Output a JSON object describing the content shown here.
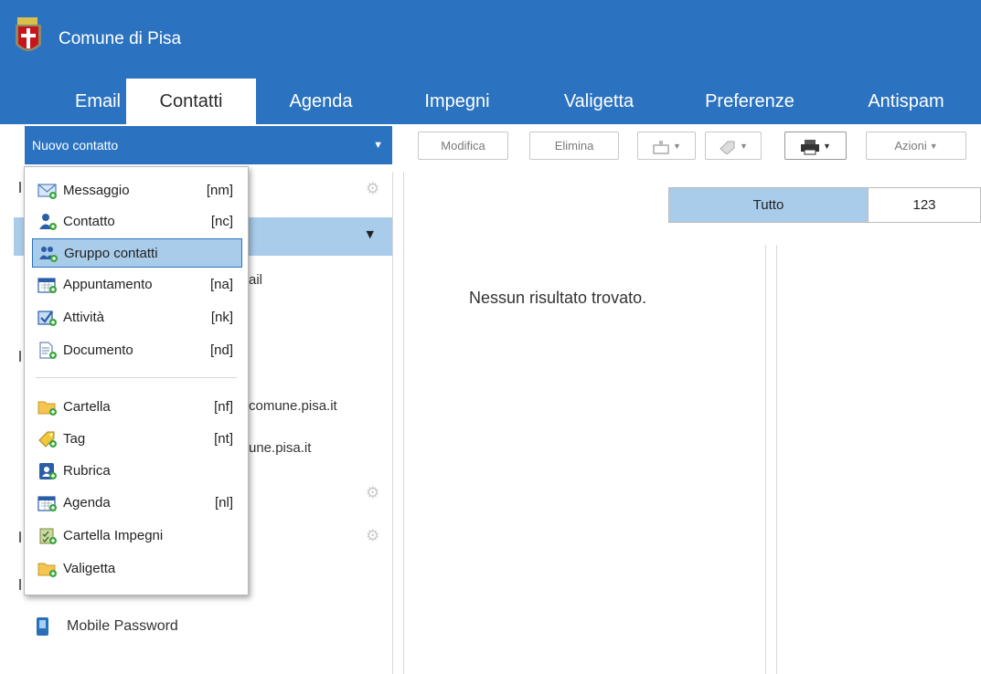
{
  "header": {
    "app_title": "Comune di Pisa",
    "tabs": [
      {
        "label": "Email"
      },
      {
        "label": "Contatti"
      },
      {
        "label": "Agenda"
      },
      {
        "label": "Impegni"
      },
      {
        "label": "Valigetta"
      },
      {
        "label": "Preferenze"
      },
      {
        "label": "Antispam"
      }
    ]
  },
  "toolbar": {
    "new_label": "Nuovo contatto",
    "edit_label": "Modifica",
    "delete_label": "Elimina",
    "actions_label": "Azioni"
  },
  "menu": {
    "items": [
      {
        "label": "Messaggio",
        "shortcut": "[nm]",
        "icon": "envelope-icon"
      },
      {
        "label": "Contatto",
        "shortcut": "[nc]",
        "icon": "contact-icon"
      },
      {
        "label": "Gruppo contatti",
        "shortcut": "",
        "icon": "contact-group-icon"
      },
      {
        "label": "Appuntamento",
        "shortcut": "[na]",
        "icon": "calendar-icon"
      },
      {
        "label": "Attività",
        "shortcut": "[nk]",
        "icon": "task-icon"
      },
      {
        "label": "Documento",
        "shortcut": "[nd]",
        "icon": "document-icon"
      },
      {
        "label": "Cartella",
        "shortcut": "[nf]",
        "icon": "folder-icon"
      },
      {
        "label": "Tag",
        "shortcut": "[nt]",
        "icon": "tag-icon"
      },
      {
        "label": "Rubrica",
        "shortcut": "",
        "icon": "addressbook-icon"
      },
      {
        "label": "Agenda",
        "shortcut": "[nl]",
        "icon": "calendar-icon"
      },
      {
        "label": "Cartella Impegni",
        "shortcut": "",
        "icon": "task-folder-icon"
      },
      {
        "label": "Valigetta",
        "shortcut": "",
        "icon": "briefcase-folder-icon"
      }
    ]
  },
  "left_pane": {
    "partial_email_suffix": "ail",
    "partial_addr_1": "comune.pisa.it",
    "partial_addr_2": "une.pisa.it",
    "mobile_password": "Mobile Password"
  },
  "filter": {
    "all_label": "Tutto",
    "num_label": "123"
  },
  "list": {
    "empty_message": "Nessun risultato trovato."
  },
  "colors": {
    "brand": "#2b73c0",
    "selection": "#a9cceb"
  }
}
